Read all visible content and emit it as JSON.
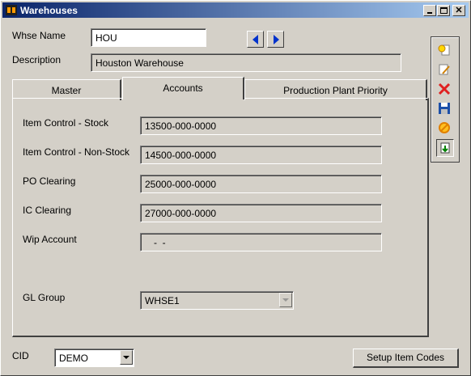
{
  "window": {
    "title": "Warehouses"
  },
  "header": {
    "whse_name_label": "Whse Name",
    "whse_name_value": "HOU",
    "description_label": "Description",
    "description_value": "Houston Warehouse"
  },
  "tabs": [
    {
      "label": "Master"
    },
    {
      "label": "Accounts",
      "active": true
    },
    {
      "label": "Production Plant Priority"
    }
  ],
  "accounts": {
    "item_control_stock_label": "Item Control - Stock",
    "item_control_stock_value": "13500-000-0000",
    "item_control_nonstock_label": "Item Control - Non-Stock",
    "item_control_nonstock_value": "14500-000-0000",
    "po_clearing_label": "PO Clearing",
    "po_clearing_value": "25000-000-0000",
    "ic_clearing_label": "IC Clearing",
    "ic_clearing_value": "27000-000-0000",
    "wip_account_label": "Wip Account",
    "wip_account_value": "-  -",
    "gl_group_label": "GL Group",
    "gl_group_value": "WHSE1"
  },
  "footer": {
    "cid_label": "CID",
    "cid_value": "DEMO",
    "setup_item_codes_label": "Setup Item Codes"
  },
  "toolbar_icons": [
    "new-record-icon",
    "edit-record-icon",
    "delete-icon",
    "save-icon",
    "cancel-icon",
    "refresh-icon"
  ],
  "colors": {
    "titlebar_start": "#0a246a",
    "titlebar_end": "#a6caf0",
    "window_bg": "#d4d0c8",
    "delete_red": "#e02020",
    "nav_blue": "#0033cc"
  }
}
